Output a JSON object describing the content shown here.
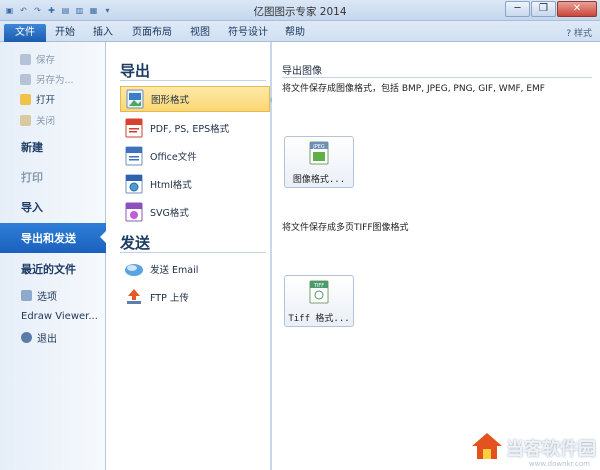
{
  "app": {
    "title": "亿图图示专家 2014",
    "window_controls": [
      "─",
      "❐",
      "✕"
    ]
  },
  "ribbon": {
    "tabs": [
      "文件",
      "开始",
      "插入",
      "页面布局",
      "视图",
      "符号设计",
      "帮助"
    ],
    "right_label": "样式"
  },
  "nav": {
    "save": "保存",
    "save_as": "另存为...",
    "open": "打开",
    "close": "关闭",
    "new": "新建",
    "print": "打印",
    "import": "导入",
    "export_send": "导出和发送",
    "recent": "最近的文件",
    "options": "选项",
    "edraw_viewer": "Edraw Viewer...",
    "exit": "退出"
  },
  "export": {
    "title": "导出",
    "items": [
      {
        "label": "图形格式",
        "icon": "image-format-icon"
      },
      {
        "label": "PDF, PS, EPS格式",
        "icon": "pdf-icon"
      },
      {
        "label": "Office文件",
        "icon": "office-doc-icon"
      },
      {
        "label": "Html格式",
        "icon": "html-icon"
      },
      {
        "label": "SVG格式",
        "icon": "svg-icon"
      }
    ]
  },
  "send": {
    "title": "发送",
    "items": [
      {
        "label": "发送 Email",
        "icon": "email-icon"
      },
      {
        "label": "FTP 上传",
        "icon": "ftp-upload-icon"
      }
    ]
  },
  "panel": {
    "heading": "导出图像",
    "desc1": "将文件保存成图像格式，包括 BMP, JPEG, PNG, GIF, WMF, EMF",
    "button1": "图像格式...",
    "button1_icon_label": "JPEG",
    "desc2": "将文件保存成多页TIFF图像格式",
    "button2": "Tiff 格式...",
    "button2_icon_label": "TIFF"
  },
  "watermark": {
    "text": "当客软件园",
    "url": "www.downkr.com"
  }
}
